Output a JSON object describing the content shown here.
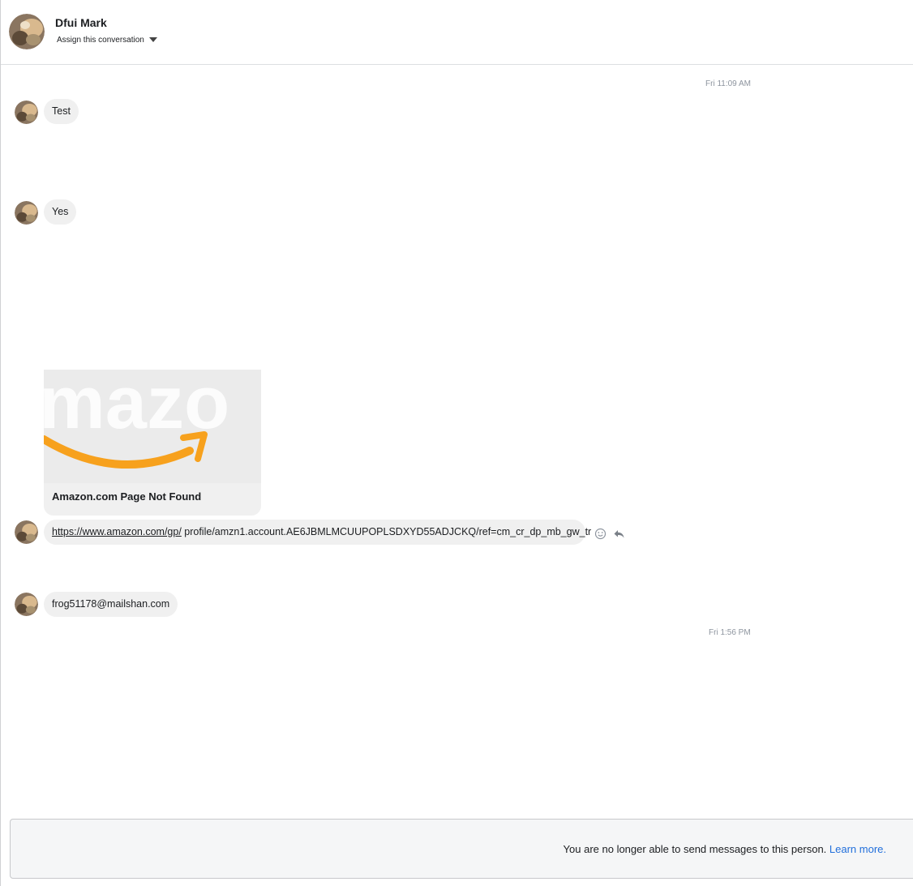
{
  "header": {
    "name": "Dfui Mark",
    "assign_label": "Assign this conversation"
  },
  "thread": {
    "timestamp_1": "Fri 11:09 AM",
    "timestamp_2": "Fri 1:56 PM",
    "messages": [
      {
        "text": "Test"
      },
      {
        "text": "Yes"
      },
      {
        "link_card_title": "Amazon.com Page Not Found",
        "link_url_part1": "https://www.amazon.com/gp/",
        "link_url_part2": " profile/amzn1.account.AE6JBMLMCUUPOPLSDXYD55ADJCKQ/ref=cm_cr_dp_mb_gw_tr"
      },
      {
        "text": "frog51178@mailshan.com"
      }
    ],
    "actions": {
      "react_icon": "smiley-icon",
      "reply_icon": "reply-icon"
    }
  },
  "footer": {
    "notice": "You are no longer able to send messages to this person.",
    "learn_more": "Learn more."
  },
  "colors": {
    "bubble": "#f0f0f0",
    "link": "#216fdb",
    "timestamp": "#8d949e",
    "amazon_orange": "#f7a11d"
  }
}
